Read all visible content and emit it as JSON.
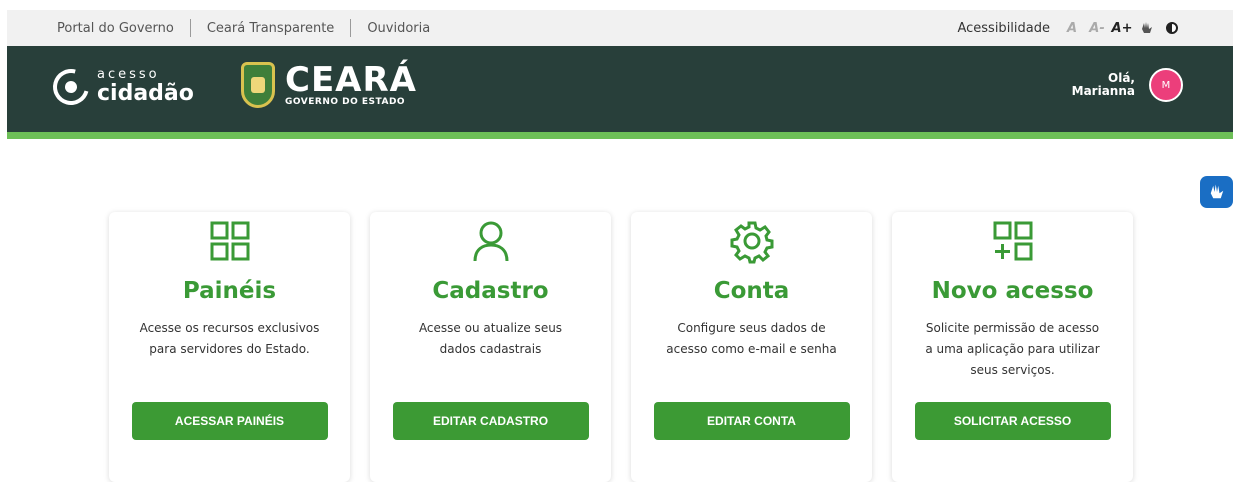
{
  "topbar": {
    "links": [
      "Portal do Governo",
      "Ceará Transparente",
      "Ouvidoria"
    ],
    "accessibility_label": "Acessibilidade",
    "font_buttons": [
      "A",
      "A-",
      "A+"
    ]
  },
  "header": {
    "logo_small": "acesso",
    "logo_big": "cidadão",
    "state_name": "CEARÁ",
    "state_sub": "GOVERNO DO ESTADO",
    "greeting_line1": "Olá,",
    "greeting_line2": "Marianna",
    "avatar_initial": "M"
  },
  "colors": {
    "header_bg": "#283f3a",
    "accent_green": "#3c9a34",
    "avatar": "#ec3e7b"
  },
  "cards": [
    {
      "icon": "grid-icon",
      "title": "Painéis",
      "desc": "Acesse os recursos exclusivos para servidores do Estado.",
      "button": "ACESSAR PAINÉIS"
    },
    {
      "icon": "user-icon",
      "title": "Cadastro",
      "desc": "Acesse ou atualize seus dados cadastrais",
      "button": "EDITAR CADASTRO"
    },
    {
      "icon": "gear-icon",
      "title": "Conta",
      "desc": "Configure seus dados de acesso como e-mail e senha",
      "button": "EDITAR CONTA"
    },
    {
      "icon": "grid-plus-icon",
      "title": "Novo acesso",
      "desc": "Solicite permissão de acesso a uma aplicação para utilizar seus serviços.",
      "button": "SOLICITAR ACESSO"
    }
  ]
}
